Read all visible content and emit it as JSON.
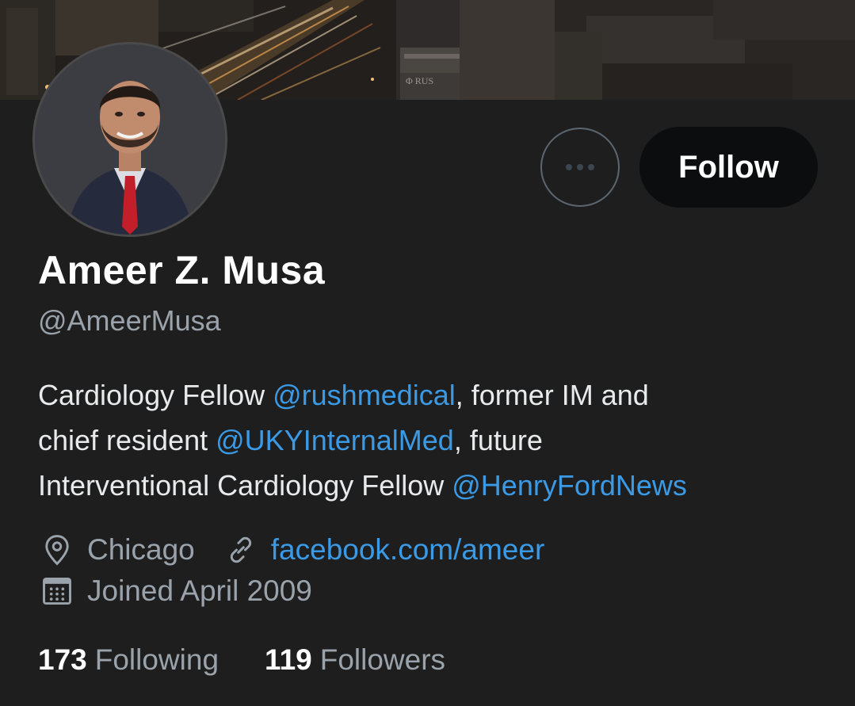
{
  "profile": {
    "display_name": "Ameer Z. Musa",
    "handle": "@AmeerMusa",
    "bio": {
      "line1": {
        "text_a": "Cardiology Fellow ",
        "mention": "@rushmedical",
        "text_b": ", former IM and"
      },
      "line2": {
        "text_a": "chief resident ",
        "mention": "@UKYInternalMed",
        "text_b": ", future"
      },
      "line3": {
        "text_a": "Interventional Cardiology Fellow ",
        "mention": "@HenryFordNews"
      }
    },
    "location": "Chicago",
    "website": "facebook.com/ameer",
    "joined": "Joined April 2009",
    "stats": {
      "following_count": "173",
      "following_label": "Following",
      "followers_count": "119",
      "followers_label": "Followers"
    }
  },
  "actions": {
    "follow_label": "Follow",
    "more_icon": "more-horizontal-icon"
  },
  "icons": {
    "location": "location-pin-icon",
    "link": "link-icon",
    "calendar": "calendar-icon"
  },
  "colors": {
    "background": "#1e1e1e",
    "accent": "#3b9ae6",
    "secondary_text": "#9aa3ab",
    "follow_button_bg": "#0b0d0e"
  }
}
